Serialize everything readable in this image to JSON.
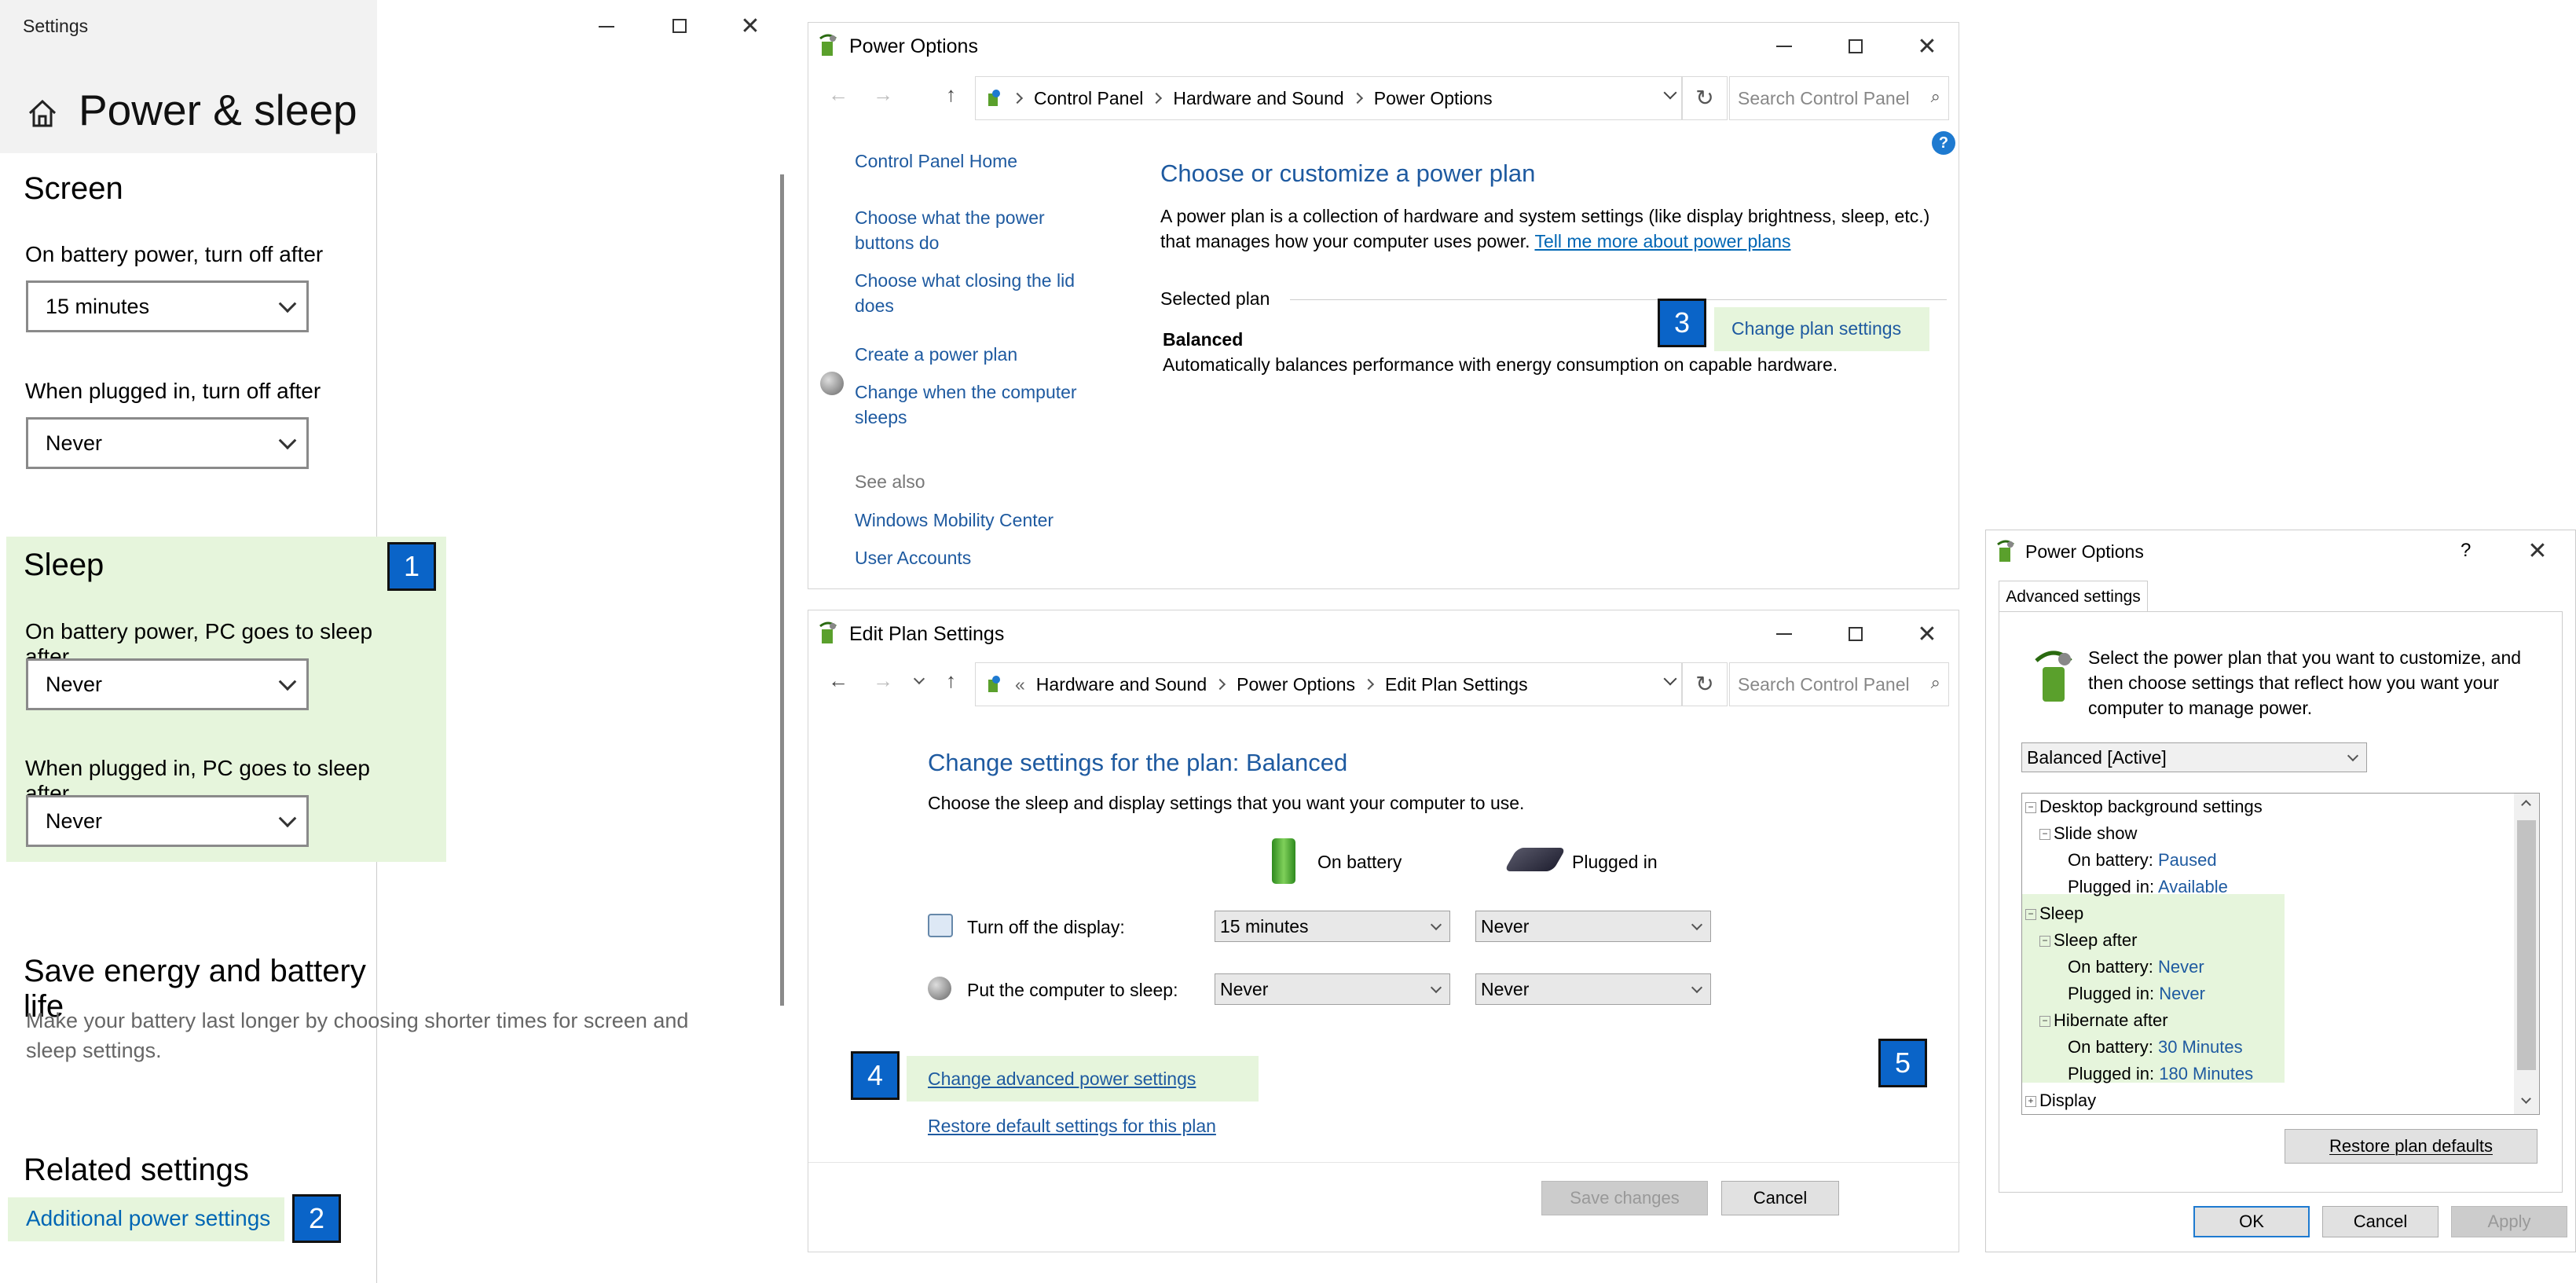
{
  "settings": {
    "window_title": "Settings",
    "page_title": "Power & sleep",
    "screen": {
      "heading": "Screen",
      "battery_label": "On battery power, turn off after",
      "battery_value": "15 minutes",
      "plugged_label": "When plugged in, turn off after",
      "plugged_value": "Never"
    },
    "sleep": {
      "heading": "Sleep",
      "battery_label": "On battery power, PC goes to sleep after",
      "battery_value": "Never",
      "plugged_label": "When plugged in, PC goes to sleep after",
      "plugged_value": "Never"
    },
    "save_energy": {
      "heading": "Save energy and battery life",
      "text": "Make your battery last longer by choosing shorter times for screen and sleep settings."
    },
    "related": {
      "heading": "Related settings",
      "link": "Additional power settings"
    }
  },
  "badges": [
    "1",
    "2",
    "3",
    "4",
    "5"
  ],
  "power_options": {
    "window_title": "Power Options",
    "breadcrumb": [
      "Control Panel",
      "Hardware and Sound",
      "Power Options"
    ],
    "search_placeholder": "Search Control Panel",
    "sidebar": {
      "home": "Control Panel Home",
      "links": [
        "Choose what the power buttons do",
        "Choose what closing the lid does",
        "Create a power plan",
        "Change when the computer sleeps"
      ],
      "see_also": "See also",
      "see_also_links": [
        "Windows Mobility Center",
        "User Accounts"
      ]
    },
    "main": {
      "heading": "Choose or customize a power plan",
      "desc": "A power plan is a collection of hardware and system settings (like display brightness, sleep, etc.) that manages how your computer uses power.",
      "desc_link": "Tell me more about power plans",
      "selected_plan": "Selected plan",
      "plan_name": "Balanced",
      "plan_desc": "Automatically balances performance with energy consumption on capable hardware.",
      "change_link": "Change plan settings"
    }
  },
  "edit_plan": {
    "window_title": "Edit Plan Settings",
    "breadcrumb": [
      "Hardware and Sound",
      "Power Options",
      "Edit Plan Settings"
    ],
    "breadcrumb_overflow": "«",
    "search_placeholder": "Search Control Panel",
    "heading": "Change settings for the plan: Balanced",
    "subheading": "Choose the sleep and display settings that you want your computer to use.",
    "col_battery": "On battery",
    "col_plugged": "Plugged in",
    "rows": [
      {
        "label": "Turn off the display:",
        "battery": "15 minutes",
        "plugged": "Never"
      },
      {
        "label": "Put the computer to sleep:",
        "battery": "Never",
        "plugged": "Never"
      }
    ],
    "advanced_link": "Change advanced power settings",
    "restore_link": "Restore default settings for this plan",
    "save_button": "Save changes",
    "cancel_button": "Cancel"
  },
  "advanced": {
    "window_title": "Power Options",
    "help": "?",
    "tab": "Advanced settings",
    "intro": "Select the power plan that you want to customize, and then choose settings that reflect how you want your computer to manage power.",
    "plan_select": "Balanced [Active]",
    "tree": {
      "desktop_bg": "Desktop background settings",
      "slide_show": "Slide show",
      "on_battery": "On battery:",
      "plugged_in": "Plugged in:",
      "slide_battery": "Paused",
      "slide_plugged": "Available",
      "sleep": "Sleep",
      "sleep_after": "Sleep after",
      "sleep_battery": "Never",
      "sleep_plugged": "Never",
      "hibernate_after": "Hibernate after",
      "hib_battery": "30 Minutes",
      "hib_plugged": "180 Minutes",
      "display": "Display"
    },
    "restore_button": "Restore plan defaults",
    "ok_button": "OK",
    "cancel_button": "Cancel",
    "apply_button": "Apply"
  }
}
